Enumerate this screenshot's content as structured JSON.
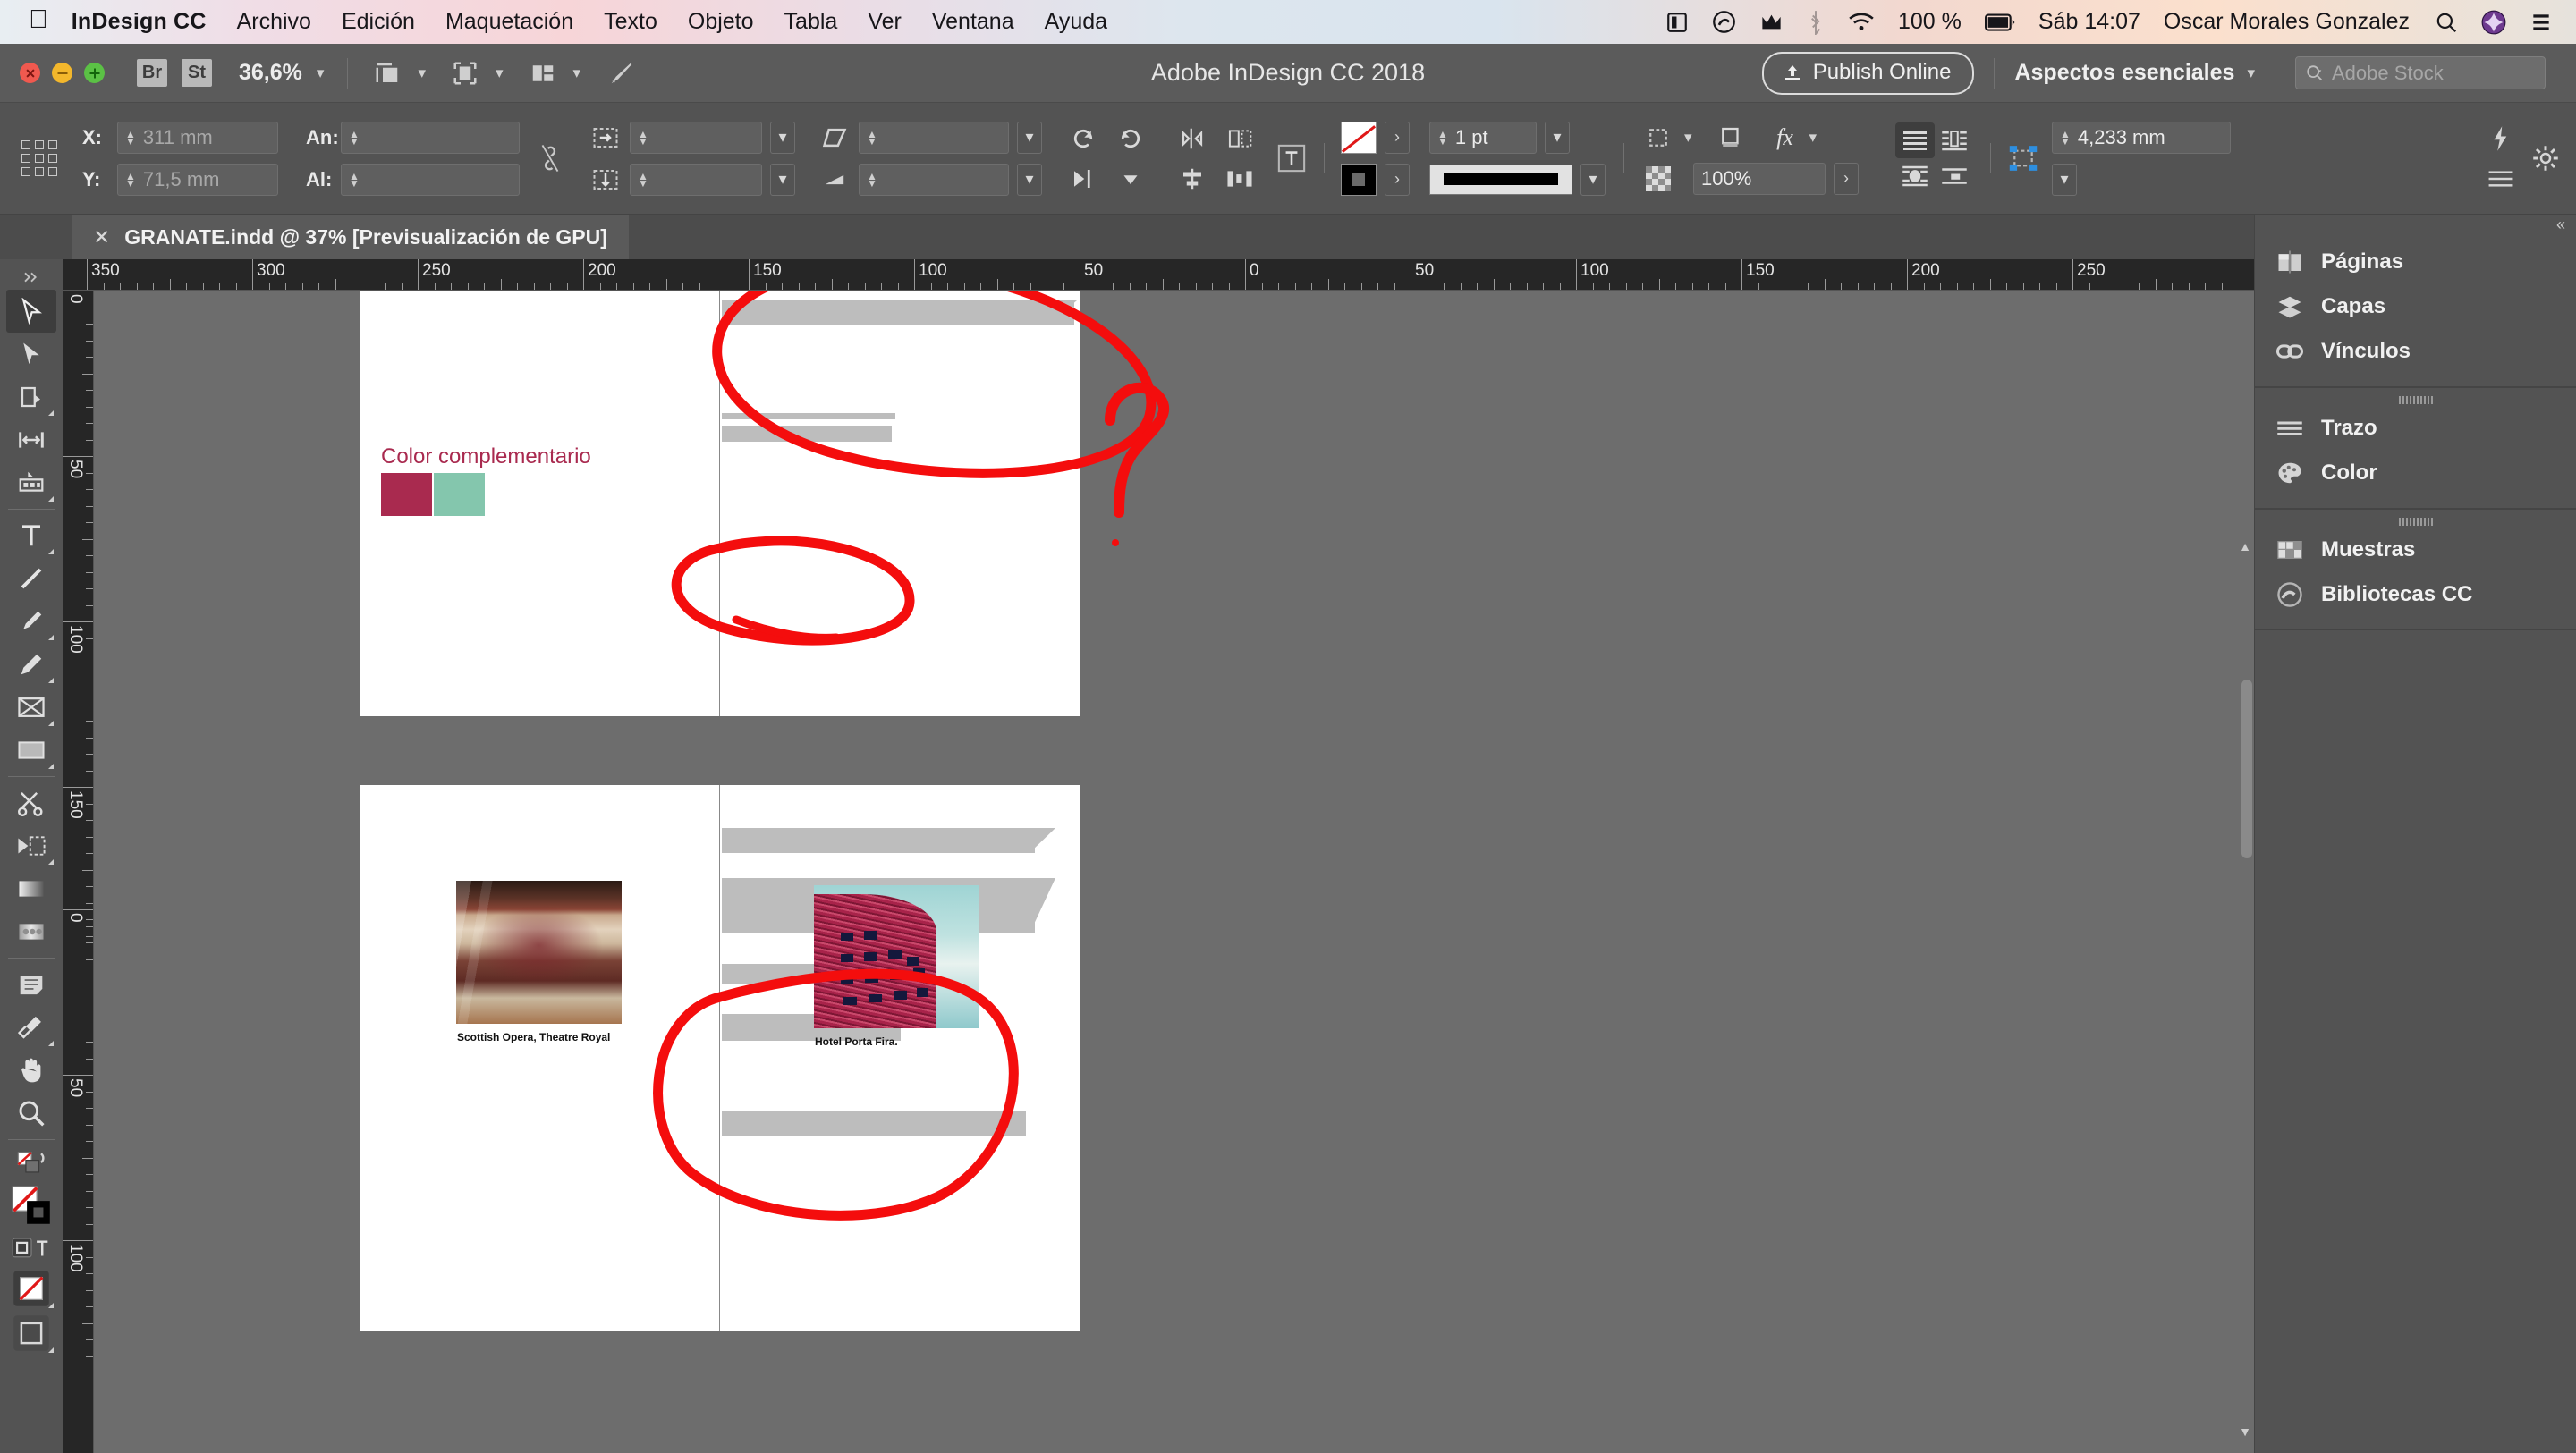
{
  "menubar": {
    "apple_icon": "apple-logo-icon",
    "app_name": "InDesign CC",
    "items": [
      "Archivo",
      "Edición",
      "Maquetación",
      "Texto",
      "Objeto",
      "Tabla",
      "Ver",
      "Ventana",
      "Ayuda"
    ],
    "status": {
      "display_icon": "display-mirror-icon",
      "cc_icon": "creative-cloud-icon",
      "malware_icon": "malwarebytes-icon",
      "bluetooth_icon": "bluetooth-icon",
      "wifi_icon": "wifi-icon",
      "battery_percent": "100 %",
      "battery_icon": "battery-full-icon",
      "clock": "Sáb 14:07",
      "user": "Oscar Morales Gonzalez",
      "search_icon": "spotlight-search-icon",
      "siri_icon": "siri-icon",
      "notifications_icon": "notification-center-icon"
    }
  },
  "appbar": {
    "window_controls": [
      "close",
      "minimize",
      "zoom"
    ],
    "bridge_label": "Br",
    "stock_label": "St",
    "zoom_level": "36,6%",
    "view_icons": [
      "screen-mode-icon",
      "frame-view-icon",
      "arrange-documents-icon",
      "brush-icon"
    ],
    "title": "Adobe InDesign CC 2018",
    "publish_label": "Publish Online",
    "publish_icon": "upload-icon",
    "workspace": "Aspectos esenciales",
    "search_placeholder": "Adobe Stock",
    "search_icon": "search-icon"
  },
  "control_bar": {
    "x_label": "X:",
    "x_value": "311 mm",
    "y_label": "Y:",
    "y_value": "71,5 mm",
    "w_label": "An:",
    "w_value": "",
    "h_label": "Al:",
    "h_value": "",
    "constrain_icon": "unlink-proportions-icon",
    "rotate_ccw_icon": "rotate-counterclockwise-icon",
    "rotate_cw_icon": "rotate-clockwise-icon",
    "flip_h_icon": "flip-horizontal-icon",
    "flip_v_icon": "flip-vertical-icon",
    "shear_icon": "shear-icon",
    "scale_x_value": "",
    "scale_y_value": "",
    "stroke_none_label": "none-swatch",
    "fill_black_label": "black-swatch",
    "stroke_weight": "1 pt",
    "stroke_style_icon": "solid-line-icon",
    "opacity": "100%",
    "corner_options_icon": "corner-options-icon",
    "effects_icon": "fx-icon",
    "frame_fit_icon": "frame-fitting-icon",
    "gap_value": "4,233 mm",
    "corner_shape_icon": "corner-shape-icon",
    "text_wrap_icons": [
      "wrap-none-icon",
      "wrap-bounding-box-icon",
      "wrap-object-shape-icon",
      "wrap-jump-object-icon"
    ],
    "align_icons": [
      "align-left-icon",
      "align-center-icon",
      "align-right-icon",
      "distribute-icon"
    ]
  },
  "document_tab": {
    "close_icon": "close-tab-icon",
    "title": "GRANATE.indd @ 37% [Previsualización de GPU]"
  },
  "tools": [
    {
      "name": "selection-tool",
      "icon": "arrow-outline-icon",
      "selected": true
    },
    {
      "name": "direct-selection-tool",
      "icon": "arrow-solid-icon",
      "selected": false
    },
    {
      "name": "page-tool",
      "icon": "page-icon",
      "selected": false
    },
    {
      "name": "gap-tool",
      "icon": "gap-arrows-icon",
      "selected": false
    },
    {
      "name": "content-collector-tool",
      "icon": "content-collector-icon",
      "selected": false
    },
    {
      "name": "type-tool",
      "icon": "type-t-icon",
      "selected": false
    },
    {
      "name": "line-tool",
      "icon": "line-diagonal-icon",
      "selected": false
    },
    {
      "name": "pen-tool",
      "icon": "pen-nib-icon",
      "selected": false
    },
    {
      "name": "pencil-tool",
      "icon": "pencil-icon",
      "selected": false
    },
    {
      "name": "rectangle-frame-tool",
      "icon": "frame-x-icon",
      "selected": false
    },
    {
      "name": "rectangle-tool",
      "icon": "rectangle-icon",
      "selected": false
    },
    {
      "name": "scissors-tool",
      "icon": "scissors-icon",
      "selected": false
    },
    {
      "name": "free-transform-tool",
      "icon": "free-transform-icon",
      "selected": false
    },
    {
      "name": "gradient-swatch-tool",
      "icon": "gradient-icon",
      "selected": false
    },
    {
      "name": "gradient-feather-tool",
      "icon": "gradient-feather-icon",
      "selected": false
    },
    {
      "name": "note-tool",
      "icon": "note-icon",
      "selected": false
    },
    {
      "name": "eyedropper-tool",
      "icon": "eyedropper-icon",
      "selected": false
    },
    {
      "name": "hand-tool",
      "icon": "hand-icon",
      "selected": false
    },
    {
      "name": "zoom-tool",
      "icon": "magnifier-icon",
      "selected": false
    }
  ],
  "tool_swatches": {
    "swap_icon": "swap-fill-stroke-icon",
    "default_icon": "default-fill-stroke-icon",
    "fill_label": "none-fill",
    "stroke_label": "black-stroke",
    "formatting_frame_icon": "formatting-affects-container-icon",
    "formatting_text_icon": "formatting-affects-text-icon",
    "apply_none_icon": "apply-none-icon",
    "normal_view_icon": "normal-view-mode-icon"
  },
  "rulers": {
    "units": "mm",
    "horizontal_labels": [
      "350",
      "300",
      "250",
      "200",
      "150",
      "100",
      "50",
      "0",
      "50",
      "100",
      "150",
      "200",
      "250"
    ],
    "vertical_labels": [
      "0",
      "50",
      "100",
      "150",
      "0",
      "50",
      "100"
    ]
  },
  "canvas": {
    "spread_top": {
      "swatch_title": "Color complementario",
      "swatch_colors": [
        "#a92a4f",
        "#84c6ad"
      ],
      "gray_bar_color": "#bdbdbd"
    },
    "spread_bottom": {
      "caption_left": "Scottish Opera, Theatre Royal",
      "caption_right": "Hotel Porta Fira.",
      "gray_bar_color": "#bdbdbd"
    },
    "annotations": {
      "color": "#f40d0d",
      "marks": [
        "ellipse-top-right",
        "ellipse-middle-bars",
        "question-mark",
        "ellipse-bottom-right"
      ]
    }
  },
  "dock": {
    "collapse_icon": "collapse-panels-icon",
    "groups": [
      {
        "has_grip": false,
        "items": [
          {
            "label": "Páginas",
            "icon": "pages-icon"
          },
          {
            "label": "Capas",
            "icon": "layers-icon"
          },
          {
            "label": "Vínculos",
            "icon": "links-chain-icon"
          }
        ]
      },
      {
        "has_grip": true,
        "items": [
          {
            "label": "Trazo",
            "icon": "stroke-lines-icon"
          },
          {
            "label": "Color",
            "icon": "color-palette-icon"
          }
        ]
      },
      {
        "has_grip": true,
        "items": [
          {
            "label": "Muestras",
            "icon": "swatches-grid-icon"
          },
          {
            "label": "Bibliotecas CC",
            "icon": "creative-cloud-libraries-icon"
          }
        ]
      }
    ]
  },
  "right_rail": {
    "settings_icon": "gear-icon",
    "lightning_icon": "lightning-icon",
    "menu_icon": "hamburger-menu-icon"
  }
}
